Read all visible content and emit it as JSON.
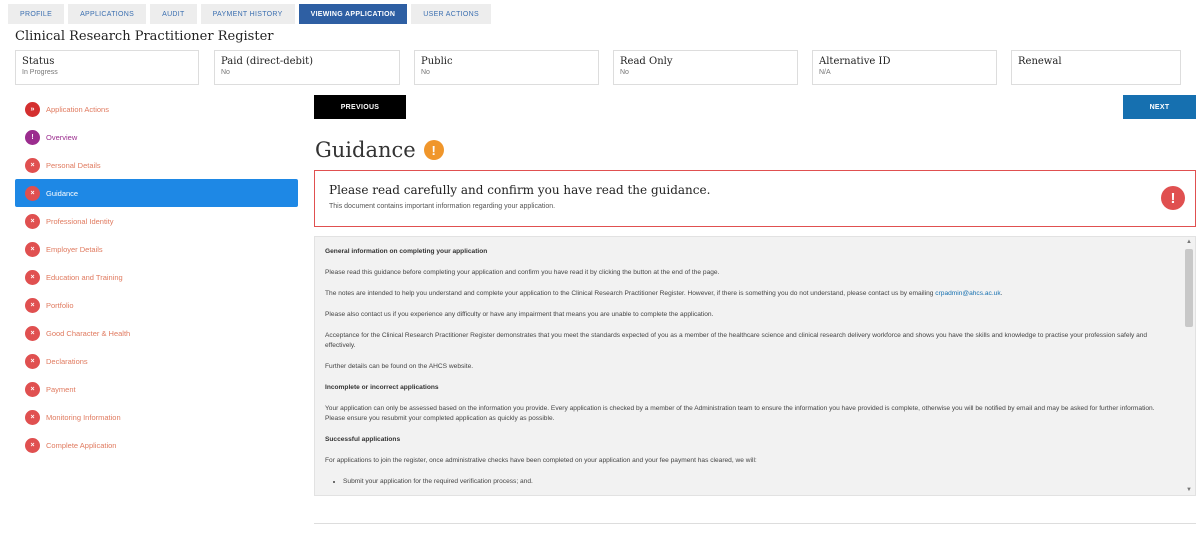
{
  "tabs": [
    {
      "label": "PROFILE"
    },
    {
      "label": "APPLICATIONS"
    },
    {
      "label": "AUDIT"
    },
    {
      "label": "PAYMENT HISTORY"
    },
    {
      "label": "VIEWING APPLICATION",
      "active": true
    },
    {
      "label": "USER ACTIONS"
    }
  ],
  "title": "Clinical Research Practitioner Register",
  "info": [
    {
      "label": "Status",
      "value": "In Progress"
    },
    {
      "label": "Paid (direct-debit)",
      "value": "No"
    },
    {
      "label": "Public",
      "value": "No"
    },
    {
      "label": "Read Only",
      "value": "No"
    },
    {
      "label": "Alternative ID",
      "value": "N/A"
    },
    {
      "label": "Renewal",
      "value": ""
    }
  ],
  "sidebar": {
    "items": [
      {
        "label": "Application Actions",
        "icon": "»"
      },
      {
        "label": "Overview",
        "icon": "!"
      },
      {
        "label": "Personal Details",
        "icon": "×"
      },
      {
        "label": "Guidance",
        "icon": "×"
      },
      {
        "label": "Professional Identity",
        "icon": "×"
      },
      {
        "label": "Employer Details",
        "icon": "×"
      },
      {
        "label": "Education and Training",
        "icon": "×"
      },
      {
        "label": "Portfolio",
        "icon": "×"
      },
      {
        "label": "Good Character & Health",
        "icon": "×"
      },
      {
        "label": "Declarations",
        "icon": "×"
      },
      {
        "label": "Payment",
        "icon": "×"
      },
      {
        "label": "Monitoring Information",
        "icon": "×"
      },
      {
        "label": "Complete Application",
        "icon": "×"
      }
    ]
  },
  "nav": {
    "previous": "PREVIOUS",
    "next": "NEXT"
  },
  "main": {
    "heading": "Guidance",
    "heading_icon": "!",
    "alert_title": "Please read carefully and confirm you have read the guidance.",
    "alert_sub": "This document contains important information regarding your application.",
    "alert_icon": "!"
  },
  "doc": {
    "h1": "General information on completing your application",
    "p1": "Please read this guidance before completing your application and confirm you have read it by clicking the button at the end of the page.",
    "p2_a": "The notes are intended to help you understand and complete your application to the Clinical Research Practitioner Register. However, if there is something you do not understand, please contact us by emailing ",
    "p2_link": "crpadmin@ahcs.ac.uk",
    "p2_b": ".",
    "p3": "Please also contact us if you experience any difficulty or have any impairment that means you are unable to complete the application.",
    "p4": "Acceptance for the Clinical Research Practitioner Register demonstrates that you meet the standards expected of you as a member of the healthcare science and clinical research delivery workforce and shows you have the skills and knowledge to practise your profession safely and effectively.",
    "p5": "Further details can be found on the AHCS website.",
    "h2": "Incomplete or incorrect applications",
    "p6": "Your application can only be assessed based on the information you provide. Every application is checked by a member of the Administration team to ensure the information you have provided is complete, otherwise you will be notified by email and may be asked for further information.  Please ensure you resubmit your completed application as quickly as possible.",
    "h3": "Successful applications",
    "p7": "For applications to join the register, once administrative checks have been completed on your application and your fee payment has cleared, we will:",
    "li1": "Submit your application for the required verification process; and."
  },
  "colors": {
    "accent": "#1e88e5",
    "tab_active": "#2e5fa3",
    "alert": "#e05050",
    "warn": "#f0962b",
    "next": "#1670b0"
  }
}
